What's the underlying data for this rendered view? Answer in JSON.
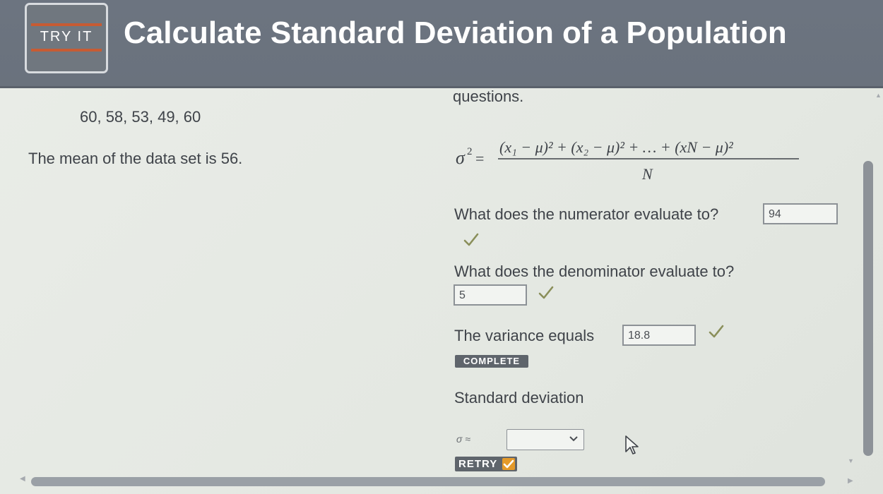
{
  "header": {
    "logo_text": "TRY IT",
    "title": "Calculate Standard Deviation of a Population"
  },
  "left": {
    "data_values": "60, 58, 53, 49, 60",
    "mean_text": "The mean of the data set is 56."
  },
  "right": {
    "questions_label": "questions.",
    "formula": {
      "lhs": "σ",
      "lhs_power": "2",
      "equals": "=",
      "numerator": "(x₁ − μ)² + (x₂ − μ)² + … + (xN − μ)²",
      "denominator": "N"
    },
    "q1": {
      "label": "What does the numerator evaluate to?",
      "value": "94"
    },
    "q2": {
      "label": "What does the denominator evaluate to?",
      "value": "5"
    },
    "q3": {
      "label": "The variance equals",
      "value": "18.8"
    },
    "complete_badge": "COMPLETE",
    "q4": {
      "label": "Standard deviation",
      "sigma_label": "σ ≈",
      "selected_value": ""
    },
    "retry_label": "RETRY"
  },
  "colors": {
    "header_bg": "#6c7480",
    "content_bg": "#e8ebe6",
    "check": "#8a8f5a",
    "badge_bg": "#5f656c",
    "retry_check_bg": "#e49a2a"
  },
  "icons": {
    "check": "check-icon",
    "select_arrow": "chevron-down-icon",
    "cursor": "mouse-pointer-icon"
  }
}
